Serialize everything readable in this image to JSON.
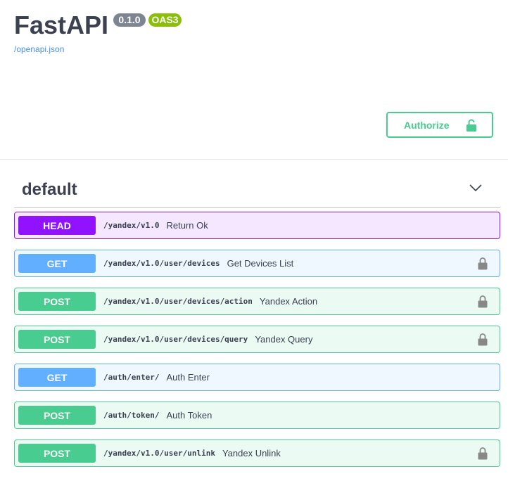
{
  "info": {
    "title": "FastAPI",
    "version_badge": "0.1.0",
    "oas_badge": "OAS3",
    "spec_link": "/openapi.json"
  },
  "authorize": {
    "label": "Authorize",
    "icon": "lock-icon"
  },
  "section": {
    "title": "default",
    "icon": "chevron-down-icon"
  },
  "operations": [
    {
      "method": "HEAD",
      "path": "/yandex/v1.0",
      "summary": "Return Ok",
      "locked": false
    },
    {
      "method": "GET",
      "path": "/yandex/v1.0/user/devices",
      "summary": "Get Devices List",
      "locked": true
    },
    {
      "method": "POST",
      "path": "/yandex/v1.0/user/devices/action",
      "summary": "Yandex Action",
      "locked": true
    },
    {
      "method": "POST",
      "path": "/yandex/v1.0/user/devices/query",
      "summary": "Yandex Query",
      "locked": true
    },
    {
      "method": "GET",
      "path": "/auth/enter/",
      "summary": "Auth Enter",
      "locked": false
    },
    {
      "method": "POST",
      "path": "/auth/token/",
      "summary": "Auth Token",
      "locked": false
    },
    {
      "method": "POST",
      "path": "/yandex/v1.0/user/unlink",
      "summary": "Yandex Unlink",
      "locked": true
    }
  ],
  "colors": {
    "head": "#9012fe",
    "get": "#61affe",
    "post": "#49cc90",
    "text": "#3b4151",
    "link": "#4990e2"
  }
}
